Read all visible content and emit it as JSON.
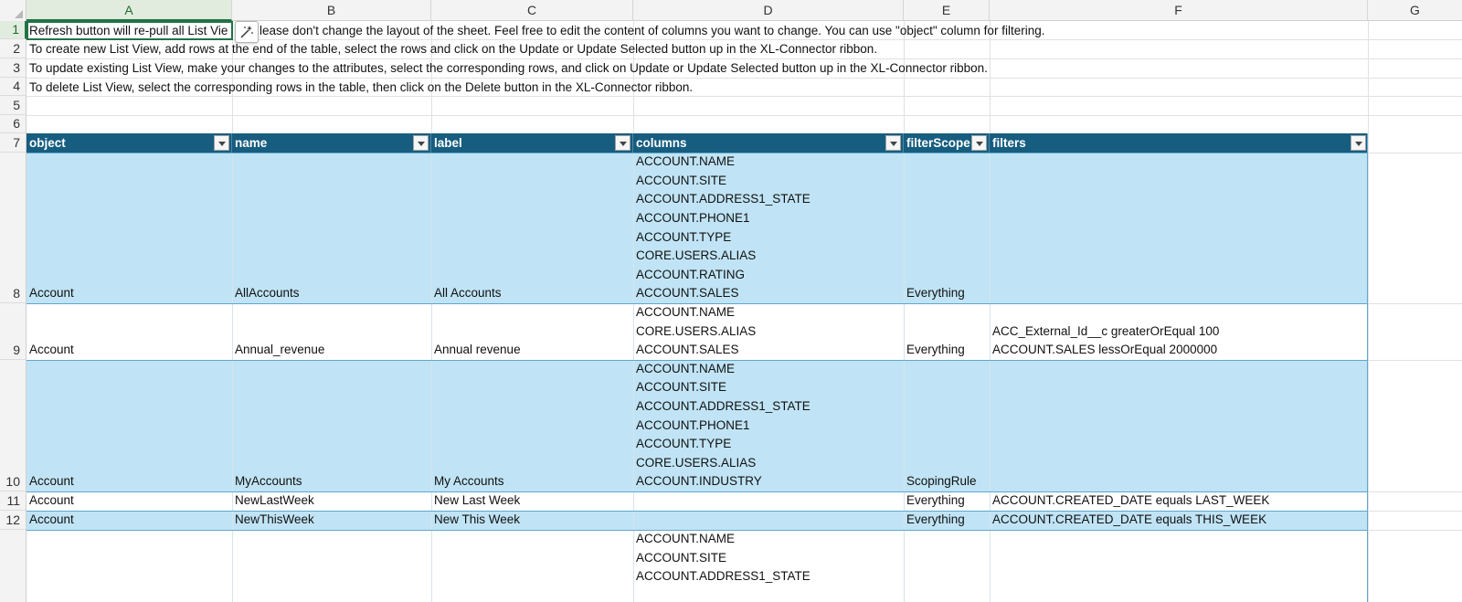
{
  "columns": [
    "A",
    "B",
    "C",
    "D",
    "E",
    "F",
    "G"
  ],
  "rows": [
    "1",
    "2",
    "3",
    "4",
    "5",
    "6",
    "7",
    "8",
    "9",
    "10",
    "11",
    "12"
  ],
  "notes": [
    "Refresh button will re-pull all List View, please don't change the layout of the sheet. Feel free to edit the content of columns you want to change. You can use \"object\" column for filtering.",
    "To create new List View, add rows at the end of the table, select the rows and click on the Update or Update Selected button up in the XL-Connector ribbon.",
    "To update existing List View, make your changes to the attributes, select the corresponding rows, and click on Update or Update Selected button up in the XL-Connector ribbon.",
    "To delete List View, select the corresponding rows in the table, then click on the Delete button in the XL-Connector ribbon."
  ],
  "note1_visible_start": "Refresh button will re-pull all List Vie",
  "note1_visible_rest": "lease don't change the layout of the sheet. Feel free to edit the content of columns you want to change. You can use \"object\" column for filtering.",
  "table": {
    "headers": [
      "object",
      "name",
      "label",
      "columns",
      "filterScope",
      "filters"
    ],
    "rows": [
      {
        "object": "Account",
        "name": "AllAccounts",
        "label": "All Accounts",
        "columns": [
          "ACCOUNT.NAME",
          "ACCOUNT.SITE",
          "ACCOUNT.ADDRESS1_STATE",
          "ACCOUNT.PHONE1",
          "ACCOUNT.TYPE",
          "CORE.USERS.ALIAS",
          "ACCOUNT.RATING",
          "ACCOUNT.SALES"
        ],
        "filterScope": "Everything",
        "filters": []
      },
      {
        "object": "Account",
        "name": "Annual_revenue",
        "label": "Annual revenue",
        "columns": [
          "ACCOUNT.NAME",
          "CORE.USERS.ALIAS",
          "ACCOUNT.SALES"
        ],
        "filterScope": "Everything",
        "filters": [
          "ACC_External_Id__c greaterOrEqual 100",
          "ACCOUNT.SALES lessOrEqual 2000000"
        ]
      },
      {
        "object": "Account",
        "name": "MyAccounts",
        "label": "My Accounts",
        "columns": [
          "ACCOUNT.NAME",
          "ACCOUNT.SITE",
          "ACCOUNT.ADDRESS1_STATE",
          "ACCOUNT.PHONE1",
          "ACCOUNT.TYPE",
          "CORE.USERS.ALIAS",
          "ACCOUNT.INDUSTRY"
        ],
        "filterScope": "ScopingRule",
        "filters": []
      },
      {
        "object": "Account",
        "name": "NewLastWeek",
        "label": "New Last Week",
        "columns": [],
        "filterScope": "Everything",
        "filters": [
          "ACCOUNT.CREATED_DATE equals LAST_WEEK"
        ]
      },
      {
        "object": "Account",
        "name": "NewThisWeek",
        "label": "New This Week",
        "columns": [],
        "filterScope": "Everything",
        "filters": [
          "ACCOUNT.CREATED_DATE equals THIS_WEEK"
        ]
      },
      {
        "object": "",
        "name": "",
        "label": "",
        "columns": [
          "ACCOUNT.NAME",
          "ACCOUNT.SITE",
          "ACCOUNT.ADDRESS1_STATE"
        ],
        "filterScope": "",
        "filters": []
      }
    ]
  },
  "icons": {
    "ideas": "magic-wand-icon",
    "filter": "filter-dropdown-icon"
  },
  "colors": {
    "header_bg": "#175d80",
    "band_blue": "#c0e4f5",
    "selection": "#217346"
  }
}
